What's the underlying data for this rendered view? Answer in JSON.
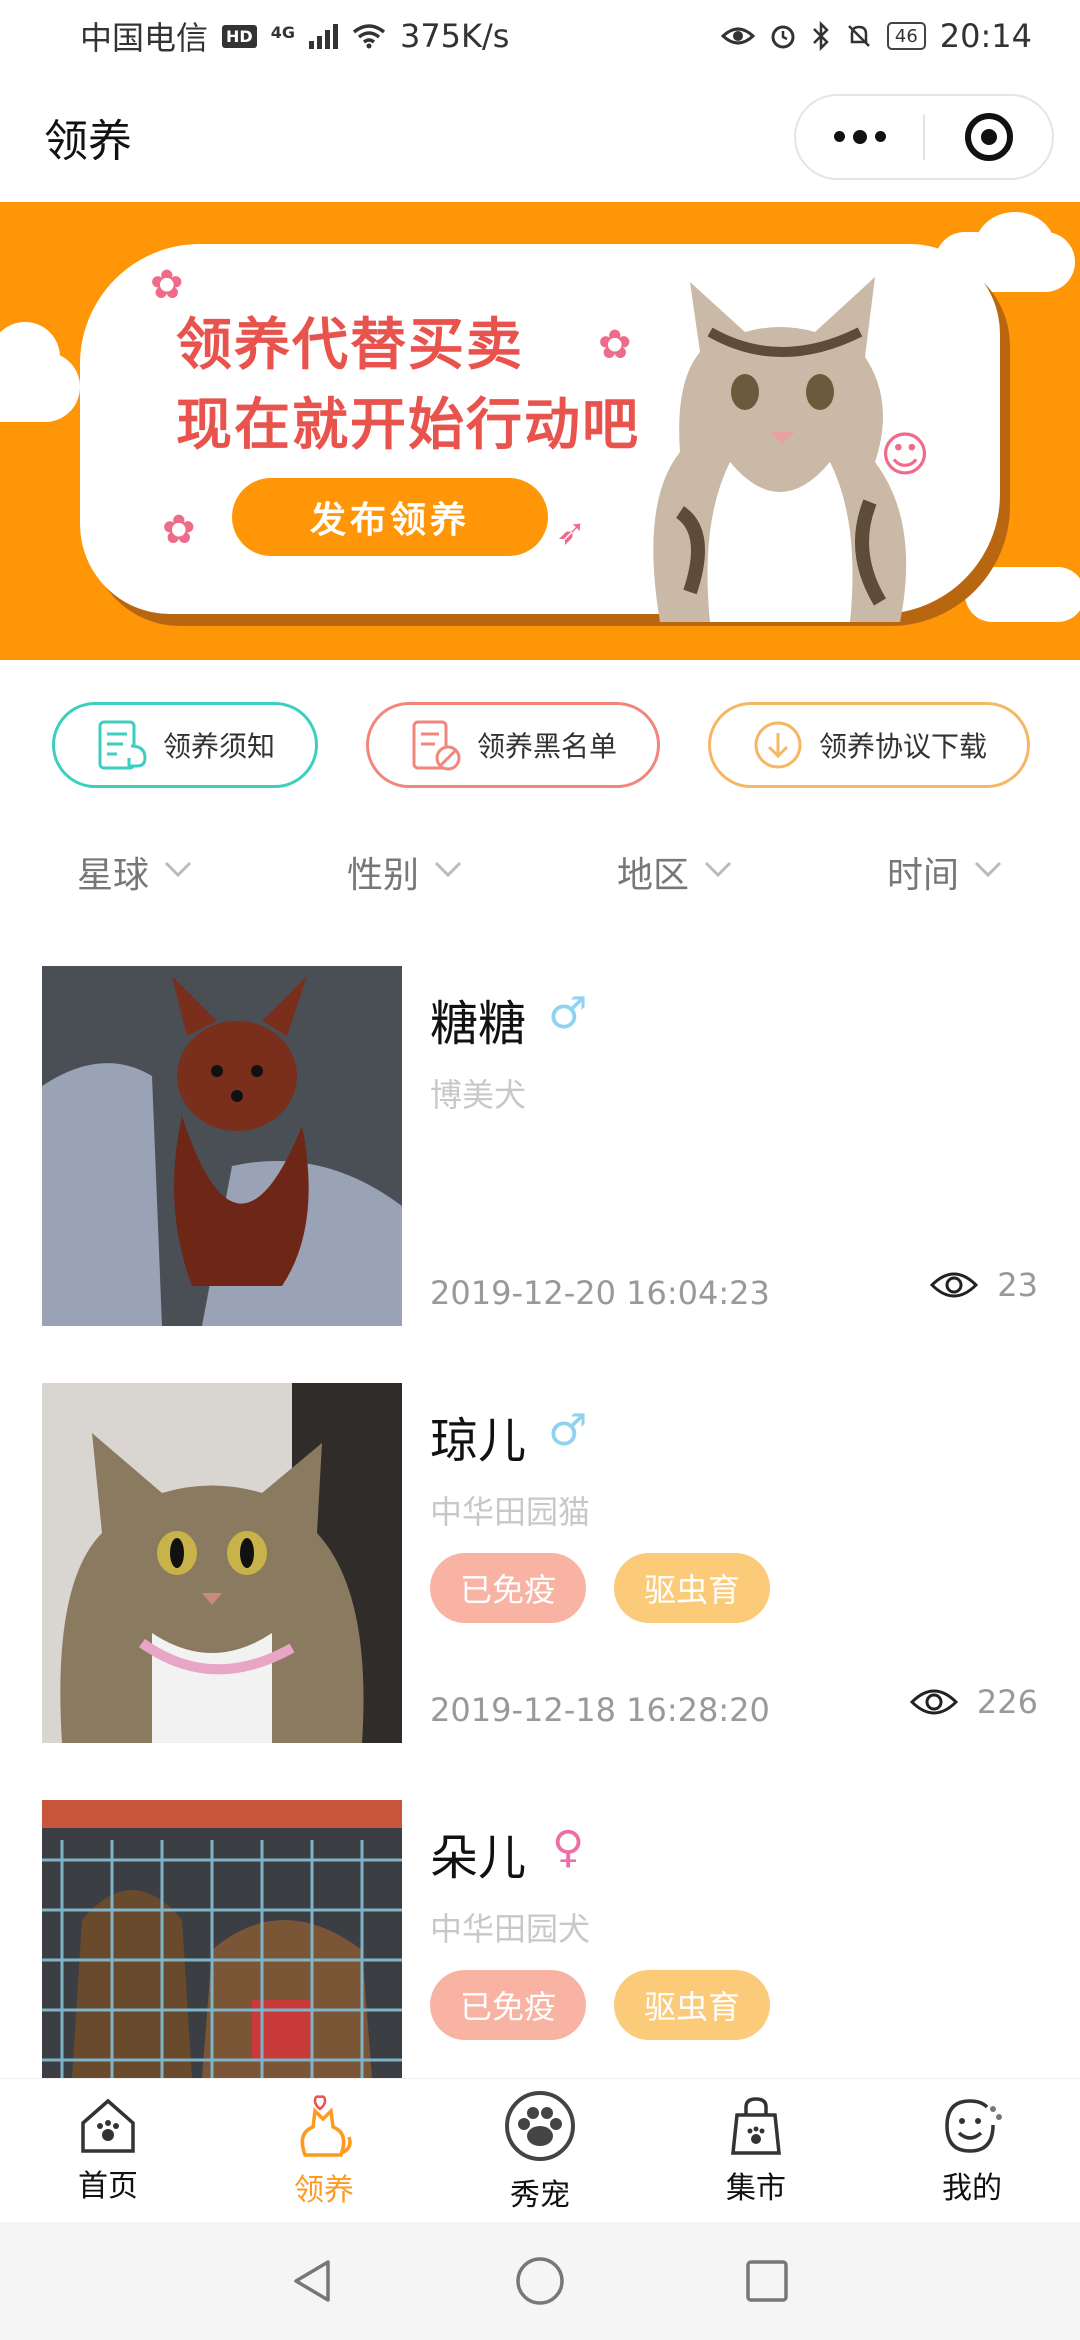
{
  "status_bar": {
    "carrier": "中国电信",
    "hd": "HD",
    "network": "4G",
    "speed": "375K/s",
    "battery": "46",
    "time": "20:14"
  },
  "header": {
    "title": "领养",
    "more_icon": "more-dots-icon",
    "target_icon": "target-icon"
  },
  "banner": {
    "line1": "领养代替买卖",
    "line2": "现在就开始行动吧",
    "button_label": "发布领养",
    "bg_color": "#ff9607",
    "text_color": "#e8534d"
  },
  "actions": [
    {
      "label": "领养须知",
      "icon": "notice-doc-icon",
      "color": "#3ccfbf"
    },
    {
      "label": "领养黑名单",
      "icon": "blacklist-doc-icon",
      "color": "#f0867c"
    },
    {
      "label": "领养协议下载",
      "icon": "download-icon",
      "color": "#f5b764"
    }
  ],
  "filters": [
    {
      "label": "星球"
    },
    {
      "label": "性别"
    },
    {
      "label": "地区"
    },
    {
      "label": "时间"
    }
  ],
  "pets": [
    {
      "name": "糖糖",
      "gender": "male",
      "gender_symbol": "♂",
      "breed": "博美犬",
      "tags": [],
      "date": "2019-12-20 16:04:23",
      "views": "23"
    },
    {
      "name": "琼儿",
      "gender": "male",
      "gender_symbol": "♂",
      "breed": "中华田园猫",
      "tags": [
        "已免疫",
        "驱虫育"
      ],
      "date": "2019-12-18 16:28:20",
      "views": "226"
    },
    {
      "name": "朵儿",
      "gender": "female",
      "gender_symbol": "♀",
      "breed": "中华田园犬",
      "tags": [
        "已免疫",
        "驱虫育"
      ],
      "date": "",
      "views": ""
    }
  ],
  "tabbar": [
    {
      "label": "首页",
      "icon": "home-paw-icon",
      "active": false
    },
    {
      "label": "领养",
      "icon": "adopt-cat-icon",
      "active": true
    },
    {
      "label": "秀宠",
      "icon": "paw-circle-icon",
      "active": false
    },
    {
      "label": "集市",
      "icon": "shopping-bag-icon",
      "active": false
    },
    {
      "label": "我的",
      "icon": "smiley-icon",
      "active": false
    }
  ],
  "colors": {
    "accent": "#ff9a1f",
    "male": "#8fd3f0",
    "female": "#ec6fa8"
  }
}
